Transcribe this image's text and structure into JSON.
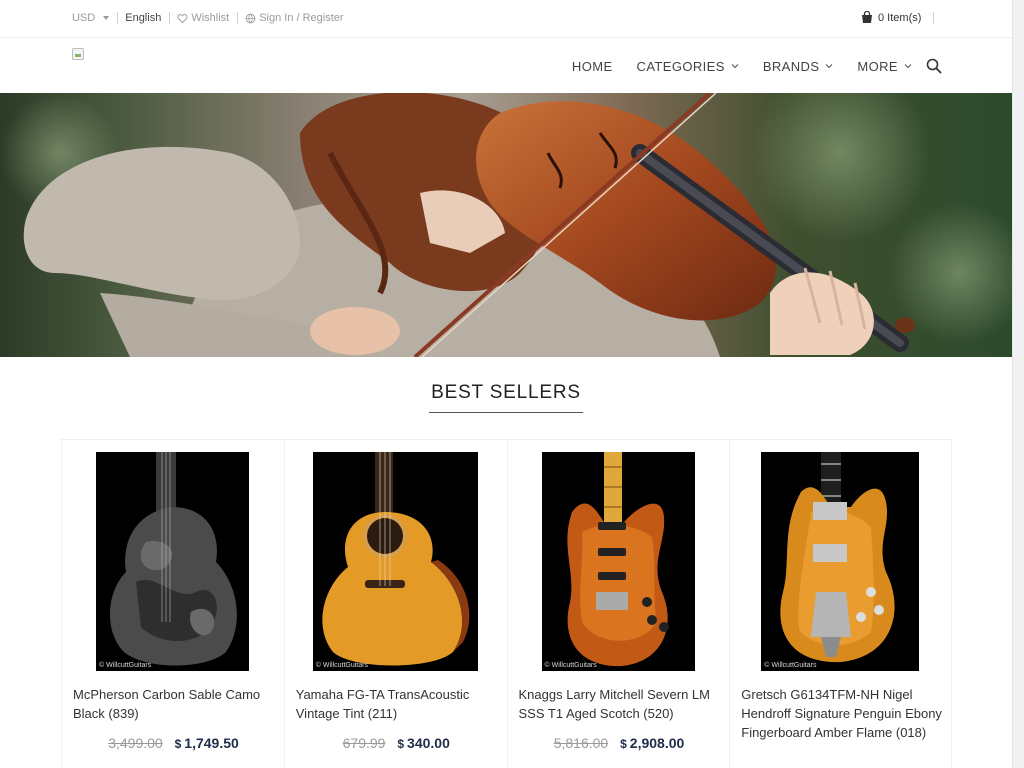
{
  "topbar": {
    "currency": "USD",
    "language": "English",
    "wishlist": "Wishlist",
    "signin": "Sign In / Register",
    "cart": "0 Item(s)"
  },
  "nav": {
    "home": "HOME",
    "categories": "CATEGORIES",
    "brands": "BRANDS",
    "more": "MORE"
  },
  "section": {
    "title": "BEST SELLERS"
  },
  "watermark": "© WillcuttGuitars",
  "products": [
    {
      "name": "McPherson Carbon Sable Camo Black (839)",
      "old_price": "3,499.00",
      "currency": "$",
      "price": "1,749.50",
      "image": "guitar-acoustic-camo-icon"
    },
    {
      "name": "Yamaha FG-TA TransAcoustic Vintage Tint (211)",
      "old_price": "679.99",
      "currency": "$",
      "price": "340.00",
      "image": "guitar-acoustic-natural-icon"
    },
    {
      "name": "Knaggs Larry Mitchell Severn LM SSS T1 Aged Scotch (520)",
      "old_price": "5,816.00",
      "currency": "$",
      "price": "2,908.00",
      "image": "guitar-electric-amber-icon"
    },
    {
      "name": "Gretsch G6134TFM-NH Nigel Hendroff Signature Penguin Ebony Fingerboard Amber Flame (018)",
      "old_price": "",
      "currency": "",
      "price": "",
      "image": "guitar-electric-gretsch-icon"
    }
  ],
  "colors": {
    "price": "#1f2d4a",
    "old_price": "#9a9a9a",
    "nav_text": "#444444"
  }
}
